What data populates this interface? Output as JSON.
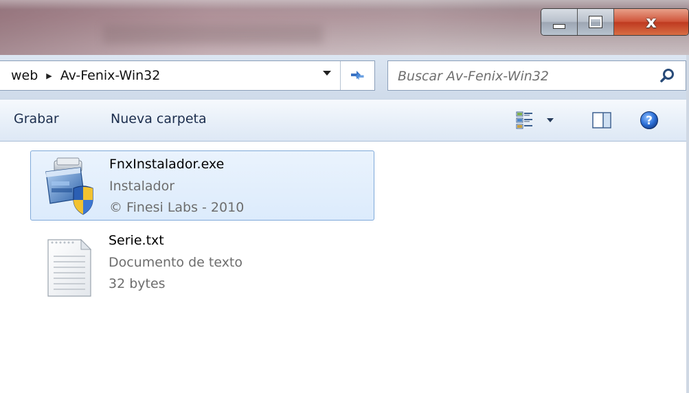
{
  "window": {
    "caption_buttons": {
      "minimize_icon": "minimize-icon",
      "maximize_icon": "maximize-icon",
      "close_glyph": "x"
    }
  },
  "address_bar": {
    "breadcrumb": [
      "web",
      "Av-Fenix-Win32"
    ],
    "separator_icon": "chevron-right-icon",
    "dropdown_icon": "chevron-down-icon",
    "refresh_icon": "refresh-icon"
  },
  "search": {
    "placeholder": "Buscar Av-Fenix-Win32",
    "icon": "search-icon"
  },
  "toolbar": {
    "grabar_label": "Grabar",
    "nueva_carpeta_label": "Nueva carpeta",
    "views_icon": "change-view-icon",
    "preview_pane_icon": "preview-pane-icon",
    "help_icon": "help-icon"
  },
  "files": [
    {
      "name": "FnxInstalador.exe",
      "type": "Instalador",
      "meta": "© Finesi Labs - 2010",
      "icon": "installer-icon",
      "selected": true
    },
    {
      "name": "Serie.txt",
      "type": "Documento de texto",
      "meta": "32 bytes",
      "icon": "text-document-icon",
      "selected": false
    }
  ],
  "colors": {
    "selection_fill": "#dcebfc",
    "selection_border": "#7fa9d9",
    "toolbar_text": "#1b2d4d",
    "secondary_text": "#6d6d6d",
    "close_button": "#c9442a"
  }
}
